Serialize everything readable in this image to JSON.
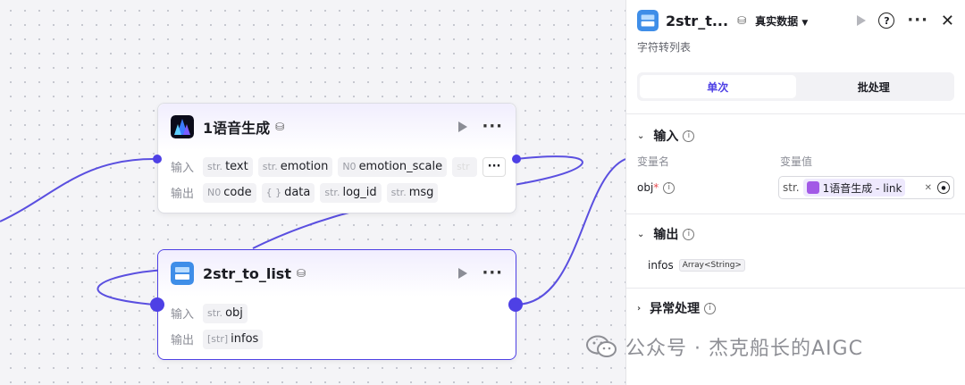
{
  "nodes": {
    "tts": {
      "title": "1语音生成",
      "input_label": "输入",
      "output_label": "输出",
      "inputs": [
        {
          "type": "str.",
          "name": "text"
        },
        {
          "type": "str.",
          "name": "emotion"
        },
        {
          "type": "N0",
          "name": "emotion_scale"
        },
        {
          "type": "str",
          "name": ""
        }
      ],
      "outputs": [
        {
          "type": "N0",
          "name": "code"
        },
        {
          "type": "{ }",
          "name": "data"
        },
        {
          "type": "str.",
          "name": "log_id"
        },
        {
          "type": "str.",
          "name": "msg"
        }
      ]
    },
    "str_to_list": {
      "title": "2str_to_list",
      "input_label": "输入",
      "output_label": "输出",
      "inputs": [
        {
          "type": "str.",
          "name": "obj"
        }
      ],
      "outputs": [
        {
          "type": "[str]",
          "name": "infos"
        }
      ]
    }
  },
  "panel": {
    "title": "2str_t...",
    "data_mode": "真实数据",
    "subtitle": "字符转列表",
    "tabs": [
      "单次",
      "批处理"
    ],
    "input_section": "输入",
    "col_name": "变量名",
    "col_value": "变量值",
    "var_name": "obj",
    "required_mark": "*",
    "value_type": "str.",
    "value_ref": "1语音生成 - link",
    "output_section": "输出",
    "output_name": "infos",
    "output_type": "Array<String>",
    "error_section": "异常处理"
  },
  "watermark": "公众号 · 杰克船长的AIGC",
  "colors": {
    "accent": "#4e40e5",
    "wire": "#5a4fe0"
  }
}
